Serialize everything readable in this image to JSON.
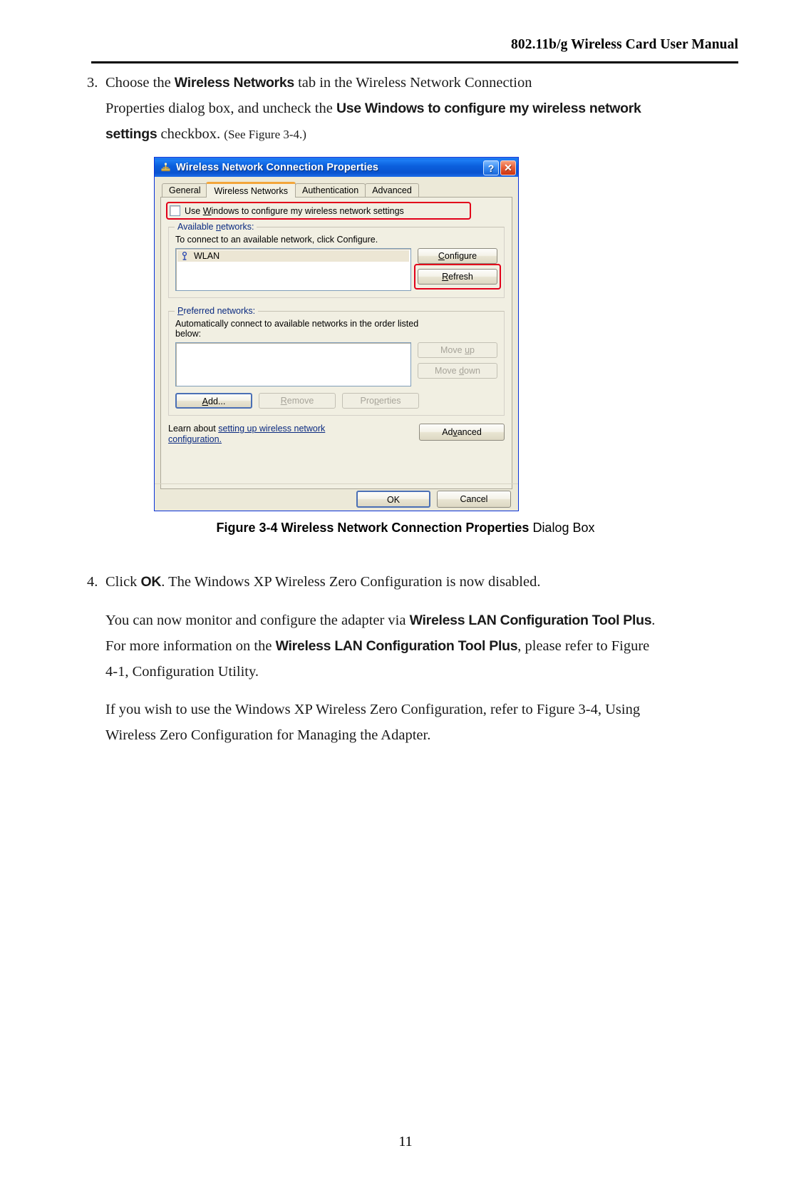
{
  "header": {
    "title": "802.11b/g Wireless Card User Manual"
  },
  "page_number": "11",
  "steps": {
    "step3": {
      "number": "3.",
      "line1_a": "Choose the ",
      "line1_bold": "Wireless Networks",
      "line1_b": " tab in the Wireless Network Connection",
      "line2_a": "Properties dialog box, and uncheck the ",
      "line2_bold": "Use Windows to configure my wireless network",
      "line3_bold": "settings",
      "line3_a": " checkbox. ",
      "line3_small": "(See Figure 3-4.)"
    },
    "step4": {
      "number": "4.",
      "line1_a": "Click ",
      "line1_bold": "OK",
      "line1_b": ". The Windows XP Wireless Zero Configuration is now disabled.",
      "para1_line1_a": "You can now monitor and configure the adapter via ",
      "para1_line1_bold": "Wireless LAN Configuration Tool Plus",
      "para1_line1_b": ".",
      "para1_line2_a": "For more information on the ",
      "para1_line2_bold": "Wireless LAN Configuration Tool Plus",
      "para1_line2_b": ", please refer to Figure",
      "para1_line3": "4-1, Configuration Utility.",
      "para2_line1": "If you wish to use the Windows XP Wireless Zero Configuration, refer to Figure 3-4, Using",
      "para2_line2": "Wireless Zero Configuration for Managing the Adapter."
    }
  },
  "figure": {
    "caption_bold": "Figure 3-4 Wireless Network Connection Properties",
    "caption_rest": " Dialog Box"
  },
  "dialog": {
    "title": "Wireless Network Connection Properties",
    "titlebar_buttons": {
      "help": "?",
      "close": "✕"
    },
    "tabs": [
      {
        "label": "General",
        "active": false
      },
      {
        "label": "Wireless Networks",
        "active": true
      },
      {
        "label": "Authentication",
        "active": false
      },
      {
        "label": "Advanced",
        "active": false
      }
    ],
    "use_windows_checkbox": {
      "label_pre": "Use ",
      "label_underline": "W",
      "label_post": "indows to configure my wireless network settings",
      "checked": false
    },
    "available_networks": {
      "title_pre": "Available ",
      "title_underline": "n",
      "title_post": "etworks:",
      "description": "To connect to an available network, click Configure.",
      "items": [
        "WLAN"
      ],
      "buttons": [
        {
          "label_pre": "",
          "label_underline": "C",
          "label_post": "onfigure",
          "enabled": true
        },
        {
          "label_pre": "",
          "label_underline": "R",
          "label_post": "efresh",
          "enabled": true
        }
      ]
    },
    "preferred_networks": {
      "title_underline": "P",
      "title_post": "referred networks:",
      "description_line1": "Automatically connect to available networks in the order listed",
      "description_line2": "below:",
      "items": [],
      "side_buttons": [
        {
          "label_pre": "Move ",
          "label_underline": "u",
          "label_post": "p",
          "enabled": false
        },
        {
          "label_pre": "Move ",
          "label_underline": "d",
          "label_post": "own",
          "enabled": false
        }
      ],
      "bottom_buttons": [
        {
          "label_pre": "",
          "label_underline": "A",
          "label_post": "dd...",
          "enabled": true
        },
        {
          "label_pre": "",
          "label_underline": "R",
          "label_post": "emove",
          "enabled": false
        },
        {
          "label_pre": "Pro",
          "label_underline": "p",
          "label_post": "erties",
          "enabled": false
        }
      ]
    },
    "learn_more": {
      "text_pre": "Learn about ",
      "link_line1": "setting up wireless network",
      "link_line2": "configuration.",
      "advanced_button": {
        "label_pre": "Ad",
        "label_underline": "v",
        "label_post": "anced"
      }
    },
    "footer_buttons": [
      {
        "label": "OK",
        "default": true
      },
      {
        "label": "Cancel",
        "default": false
      }
    ],
    "colors": {
      "titlebar": "#0a53cf",
      "face": "#ece9d8",
      "panel": "#f1efe2",
      "highlight_red": "#e2001a",
      "group_label": "#0a2a80",
      "link": "#0a2a80"
    }
  }
}
